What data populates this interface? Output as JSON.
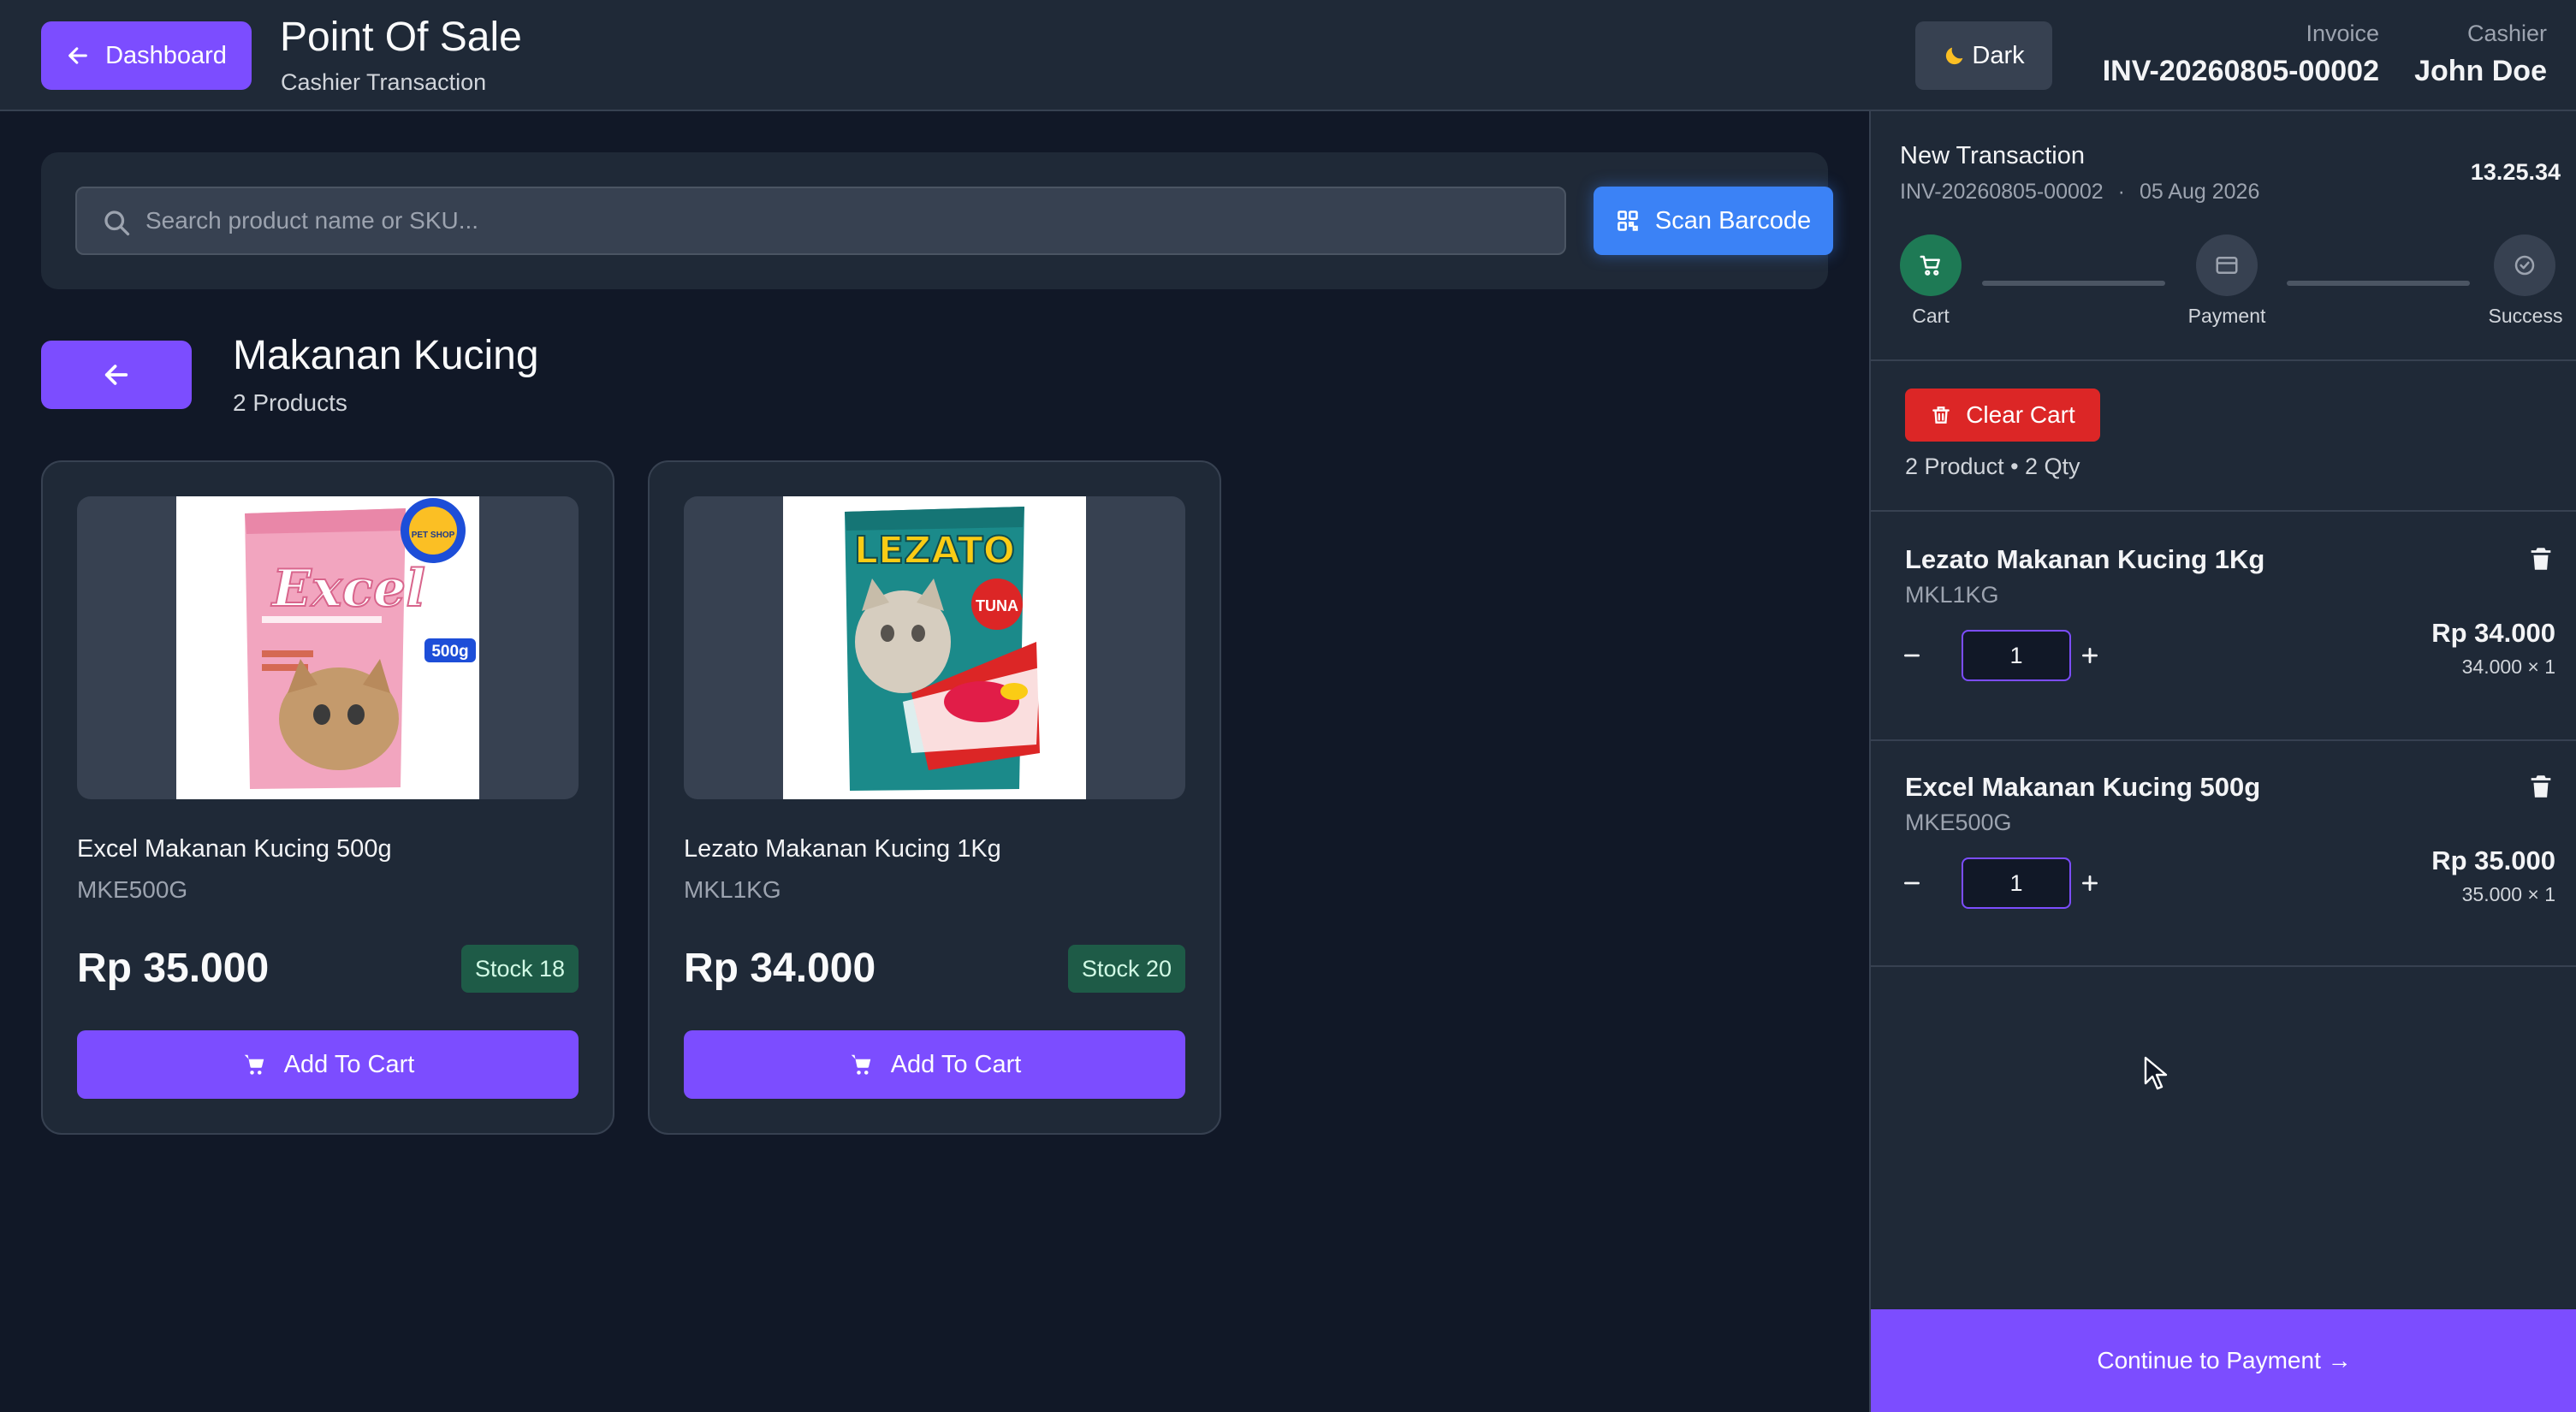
{
  "header": {
    "dashboard_label": "Dashboard",
    "title": "Point Of Sale",
    "subtitle": "Cashier Transaction",
    "theme_toggle": {
      "icon": "moon-icon",
      "label": "Dark"
    },
    "invoice_label": "Invoice",
    "invoice_value": "INV-20260805-00002",
    "cashier_label": "Cashier",
    "cashier_value": "John Doe"
  },
  "search": {
    "placeholder": "Search product name or SKU...",
    "value": "",
    "scan_label": "Scan Barcode"
  },
  "category": {
    "title": "Makanan Kucing",
    "count": "2 Products"
  },
  "products": [
    {
      "name": "Excel Makanan Kucing 500g",
      "sku": "MKE500G",
      "price": "Rp 35.000",
      "stock": "Stock 18",
      "add_label": "Add To Cart",
      "image_brand": "Excel",
      "image_badge": "500g",
      "image_seal": "PET SHOP"
    },
    {
      "name": "Lezato Makanan Kucing 1Kg",
      "sku": "MKL1KG",
      "price": "Rp 34.000",
      "stock": "Stock 20",
      "add_label": "Add To Cart",
      "image_brand": "LEZATO",
      "image_badge": "TUNA"
    }
  ],
  "transaction": {
    "title": "New Transaction",
    "invoice": "INV-20260805-00002",
    "separator": "·",
    "date": "05 Aug 2026",
    "time": "13.25.34",
    "steps": [
      {
        "label": "Cart",
        "icon": "cart-icon",
        "state": "active"
      },
      {
        "label": "Payment",
        "icon": "credit-card-icon",
        "state": "pending"
      },
      {
        "label": "Success",
        "icon": "check-circle-icon",
        "state": "pending"
      }
    ]
  },
  "cart": {
    "clear_label": "Clear Cart",
    "summary": "2 Product • 2 Qty",
    "items": [
      {
        "name": "Lezato Makanan Kucing 1Kg",
        "sku": "MKL1KG",
        "qty": "1",
        "price": "Rp 34.000",
        "unit": "34.000 × 1"
      },
      {
        "name": "Excel Makanan Kucing 500g",
        "sku": "MKE500G",
        "qty": "1",
        "price": "Rp 35.000",
        "unit": "35.000 × 1"
      }
    ],
    "continue_label": "Continue to Payment →"
  },
  "colors": {
    "background": "#111827",
    "panel": "#1f2937",
    "accent": "#7c4dff",
    "scan": "#3b82f6",
    "danger": "#dc2626",
    "success": "#1e7a55",
    "stock_badge": "#1e5b47"
  }
}
